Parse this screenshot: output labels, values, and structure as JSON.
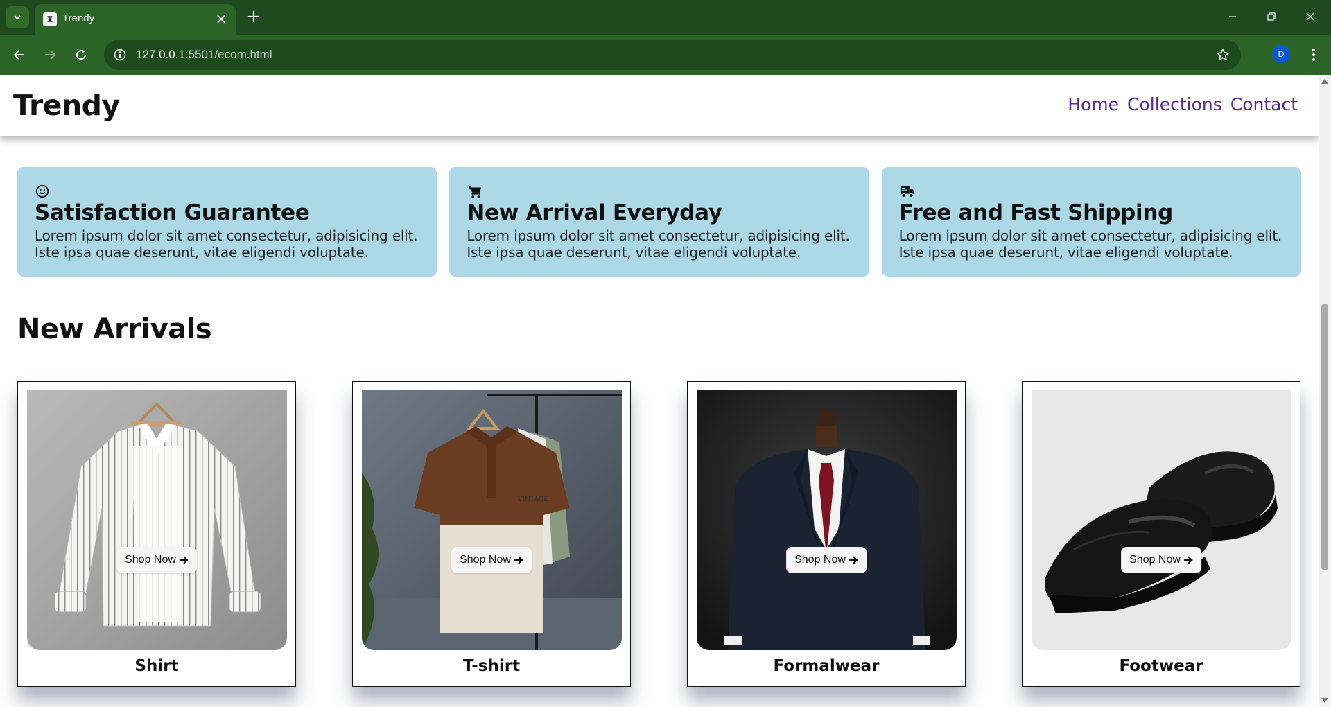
{
  "browser": {
    "tab_title": "Trendy",
    "url_host": "127.0.0.1",
    "url_rest": ":5501/ecom.html",
    "profile_initial": "D"
  },
  "site": {
    "logo": "Trendy",
    "nav": [
      "Home",
      "Collections",
      "Contact"
    ]
  },
  "features": [
    {
      "icon": "smiley-icon",
      "title": "Satisfaction Guarantee",
      "text": "Lorem ipsum dolor sit amet consectetur, adipisicing elit. Iste ipsa quae deserunt, vitae eligendi voluptate."
    },
    {
      "icon": "cart-icon",
      "title": "New Arrival Everyday",
      "text": "Lorem ipsum dolor sit amet consectetur, adipisicing elit. Iste ipsa quae deserunt, vitae eligendi voluptate."
    },
    {
      "icon": "truck-icon",
      "title": "Free and Fast Shipping",
      "text": "Lorem ipsum dolor sit amet consectetur, adipisicing elit. Iste ipsa quae deserunt, vitae eligendi voluptate."
    }
  ],
  "new_arrivals": {
    "title": "New Arrivals",
    "button_label": "Shop Now",
    "products": [
      {
        "name": "Shirt",
        "image": "striped-shirt-image"
      },
      {
        "name": "T-shirt",
        "image": "polo-tshirt-image"
      },
      {
        "name": "Formalwear",
        "image": "suit-image"
      },
      {
        "name": "Footwear",
        "image": "loafers-image"
      }
    ]
  },
  "colors": {
    "browser_frame": "#1f4a1f",
    "browser_toolbar": "#2c6428",
    "feature_bg": "#add8e6",
    "nav_link": "#5a2a8c"
  }
}
